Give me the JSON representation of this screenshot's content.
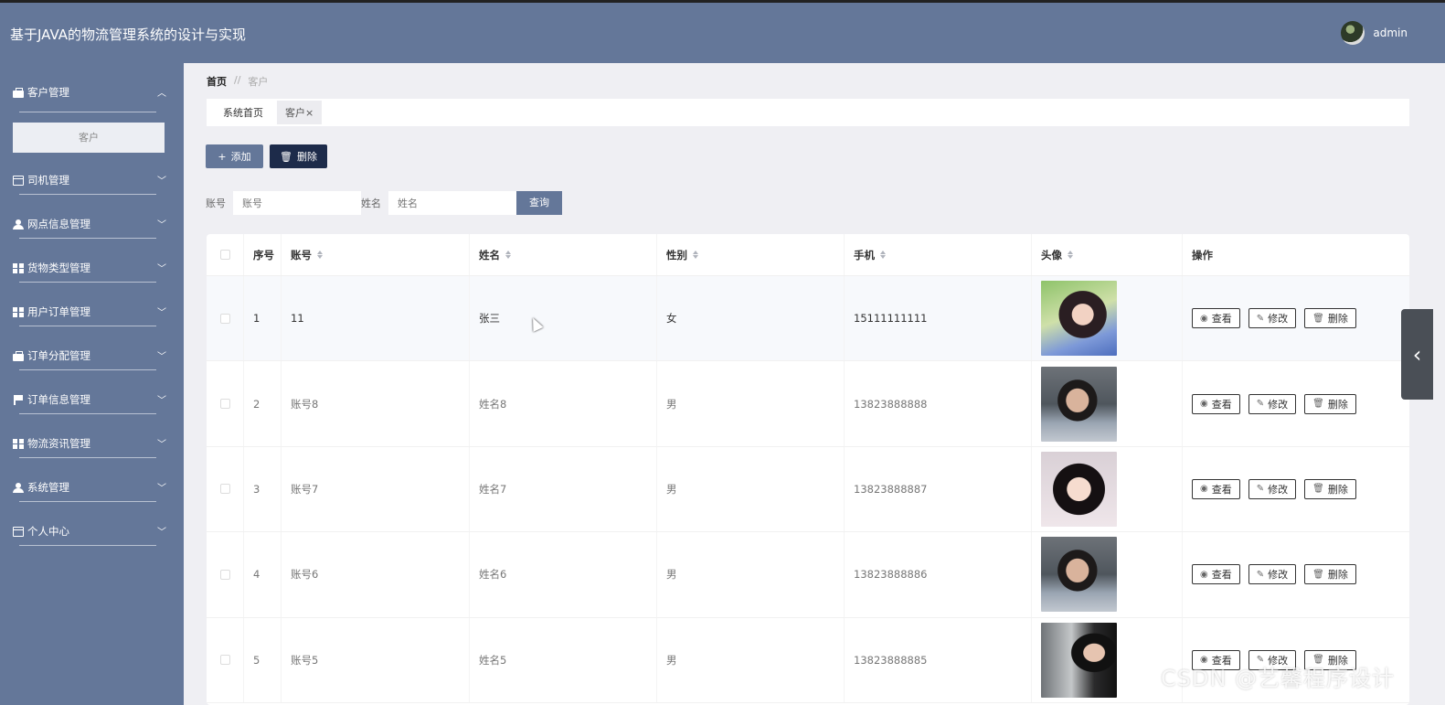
{
  "app": {
    "title": "基于JAVA的物流管理系统的设计与实现",
    "user": "admin"
  },
  "sidebar": {
    "items": [
      {
        "label": "客户管理",
        "icon": "briefcase-icon",
        "expanded": true
      },
      {
        "label": "司机管理",
        "icon": "monitor-icon"
      },
      {
        "label": "网点信息管理",
        "icon": "user-icon"
      },
      {
        "label": "货物类型管理",
        "icon": "grid-icon"
      },
      {
        "label": "用户订单管理",
        "icon": "grid-icon"
      },
      {
        "label": "订单分配管理",
        "icon": "hand-icon"
      },
      {
        "label": "订单信息管理",
        "icon": "flag-icon"
      },
      {
        "label": "物流资讯管理",
        "icon": "grid-icon"
      },
      {
        "label": "系统管理",
        "icon": "user-icon"
      },
      {
        "label": "个人中心",
        "icon": "card-icon"
      }
    ],
    "subitem": "客户"
  },
  "breadcrumb": {
    "home": "首页",
    "sep": "//",
    "current": "客户"
  },
  "tabs": [
    {
      "label": "系统首页"
    },
    {
      "label": "客户",
      "close": "×"
    }
  ],
  "toolbar": {
    "add": "添加",
    "delete": "删除"
  },
  "search": {
    "account_label": "账号",
    "account_placeholder": "账号",
    "name_label": "姓名",
    "name_placeholder": "姓名",
    "query": "查询"
  },
  "table": {
    "headers": [
      "序号",
      "账号",
      "姓名",
      "性别",
      "手机",
      "头像",
      "操作"
    ],
    "rows": [
      {
        "no": "1",
        "account": "11",
        "name": "张三",
        "gender": "女",
        "phone": "15111111111"
      },
      {
        "no": "2",
        "account": "账号8",
        "name": "姓名8",
        "gender": "男",
        "phone": "13823888888"
      },
      {
        "no": "3",
        "account": "账号7",
        "name": "姓名7",
        "gender": "男",
        "phone": "13823888887"
      },
      {
        "no": "4",
        "account": "账号6",
        "name": "姓名6",
        "gender": "男",
        "phone": "13823888886"
      },
      {
        "no": "5",
        "account": "账号5",
        "name": "姓名5",
        "gender": "男",
        "phone": "13823888885"
      }
    ],
    "actions": {
      "view": "查看",
      "edit": "修改",
      "delete": "删除"
    }
  },
  "watermark": "CSDN @艺馨程序设计",
  "colors": {
    "primary": "#647799",
    "dark": "#1d2b4a",
    "background": "#efeff3"
  }
}
